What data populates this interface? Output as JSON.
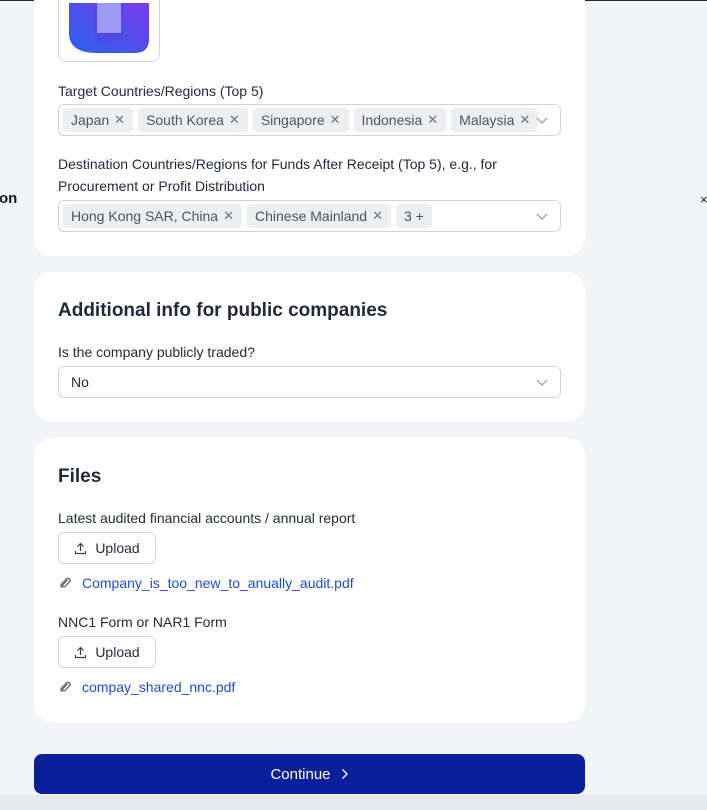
{
  "edges": {
    "left_fragment": "on",
    "right_fragment": "×"
  },
  "company_info": {
    "target_countries": {
      "label": "Target Countries/Regions (Top 5)",
      "chips": [
        "Japan",
        "South Korea",
        "Singapore",
        "Indonesia",
        "Malaysia"
      ]
    },
    "destination_countries": {
      "label": "Destination Countries/Regions for Funds After Receipt (Top 5), e.g., for Procurement or Profit Distribution",
      "chips": [
        "Hong Kong SAR, China",
        "Chinese Mainland"
      ],
      "more_count": "3 +"
    }
  },
  "public_companies": {
    "title": "Additional info for public companies",
    "question_label": "Is the company publicly traded?",
    "selected_value": "No"
  },
  "files": {
    "title": "Files",
    "items": [
      {
        "label": "Latest audited financial accounts / annual report",
        "button_label": "Upload",
        "file_name": "Company_is_too_new_to_anually_audit.pdf"
      },
      {
        "label": "NNC1 Form or NAR1 Form",
        "button_label": "Upload",
        "file_name": "compay_shared_nnc.pdf"
      }
    ]
  },
  "footer": {
    "continue_label": "Continue"
  },
  "colors": {
    "primary": "#0a1f9a",
    "link": "#1d4ed8",
    "chip_bg": "#eceef1",
    "logo_purple": "#7c3aed",
    "logo_blue": "#2563eb"
  }
}
